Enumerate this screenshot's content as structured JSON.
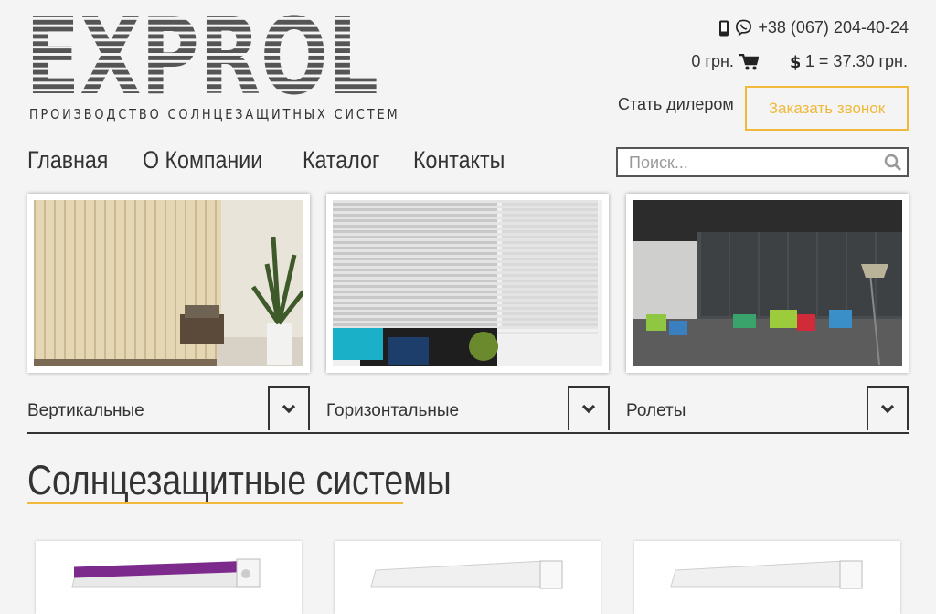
{
  "brand": {
    "logo_text": "EXPROL",
    "tagline": "ПРОИЗВОДСТВО СОЛНЦЕЗАЩИТНЫХ СИСТЕМ",
    "logo_color": "#555555"
  },
  "header": {
    "phone": "+38 (067) 204-40-24",
    "cart_total": "0 грн.",
    "exchange_rate": "1 = 37.30 грн.",
    "dealer_link": "Стать дилером",
    "callback_button": "Заказать звонок",
    "icons": [
      "mobile-icon",
      "viber-icon",
      "cart-icon",
      "dollar-icon"
    ]
  },
  "nav": {
    "items": [
      "Главная",
      "О Компании",
      "Каталог",
      "Контакты"
    ]
  },
  "search": {
    "placeholder": "Поиск..."
  },
  "categories": [
    {
      "label": "Вертикальные"
    },
    {
      "label": "Горизонтальные"
    },
    {
      "label": "Ролеты"
    }
  ],
  "section": {
    "title": "Солнцезащитные системы"
  },
  "colors": {
    "accent": "#f0b93a",
    "text": "#333333",
    "background": "#f4f4f4"
  }
}
